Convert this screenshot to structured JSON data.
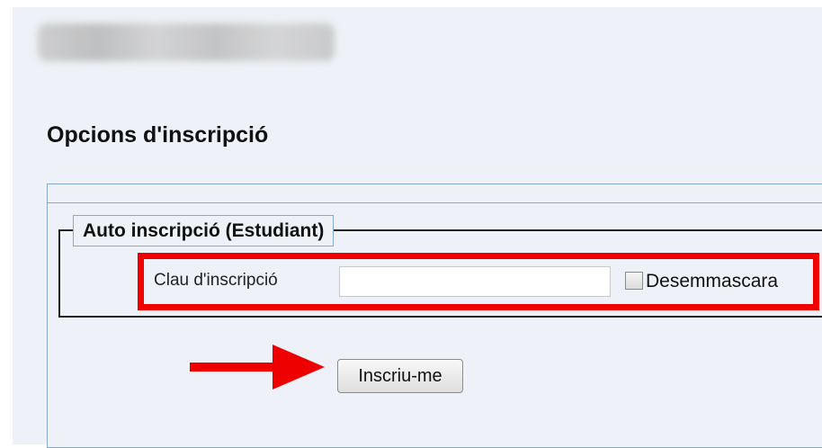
{
  "page": {
    "title": "Opcions d'inscripció"
  },
  "self_enrol": {
    "legend": "Auto inscripció (Estudiant)",
    "key_label": "Clau d'inscripció",
    "key_value": "",
    "unmask_checked": false,
    "unmask_label": "Desemmascara",
    "submit_label": "Inscriu-me"
  },
  "annotations": {
    "highlight_color": "#ee0000",
    "arrow_color": "#ee0000"
  }
}
